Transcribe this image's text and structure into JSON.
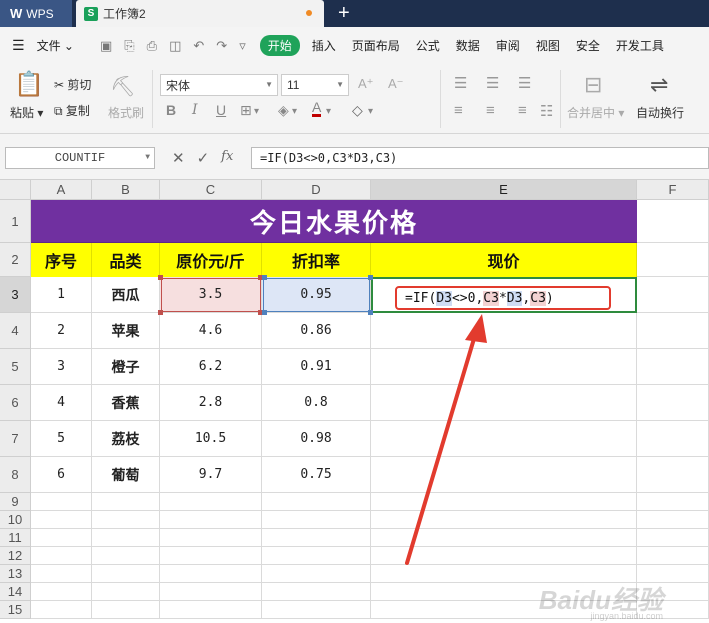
{
  "tabs": {
    "app": "WPS",
    "doc_logo": "S",
    "doc": "工作簿2",
    "add": "+"
  },
  "menu": {
    "file": "文件",
    "items": [
      "开始",
      "插入",
      "页面布局",
      "公式",
      "数据",
      "审阅",
      "视图",
      "安全",
      "开发工具"
    ]
  },
  "ribbon": {
    "paste": "粘贴",
    "cut": "剪切",
    "copy": "复制",
    "format_painter": "格式刷",
    "font_name": "宋体",
    "font_size": "11",
    "merge_center": "合并居中",
    "wrap_text": "自动换行",
    "bold": "B",
    "italic": "I",
    "underline": "U",
    "font_color_letter": "A"
  },
  "formula_bar": {
    "name_box": "COUNTIF",
    "fx": "fx",
    "formula": "=IF(D3<>0,C3*D3,C3)"
  },
  "columns": [
    "A",
    "B",
    "C",
    "D",
    "E",
    "F"
  ],
  "rows": [
    "1",
    "2",
    "3",
    "4",
    "5",
    "6",
    "7",
    "8",
    "9",
    "10",
    "11",
    "12",
    "13",
    "14",
    "15"
  ],
  "sheet": {
    "title": "今日水果价格",
    "headers": [
      "序号",
      "品类",
      "原价元/斤",
      "折扣率",
      "现价"
    ],
    "data": [
      [
        "1",
        "西瓜",
        "3.5",
        "0.95"
      ],
      [
        "2",
        "苹果",
        "4.6",
        "0.86"
      ],
      [
        "3",
        "橙子",
        "6.2",
        "0.91"
      ],
      [
        "4",
        "香蕉",
        "2.8",
        "0.8"
      ],
      [
        "5",
        "荔枝",
        "10.5",
        "0.98"
      ],
      [
        "6",
        "葡萄",
        "9.7",
        "0.75"
      ]
    ],
    "editing_formula_parts": [
      "=IF(",
      "D3",
      "<>0,",
      "C3",
      "*",
      "D3",
      ",",
      "C3",
      ")"
    ]
  },
  "watermark": {
    "main": "Baidu经验",
    "sub": "jingyan.baidu.com"
  },
  "colors": {
    "title_bg": "#7030a0",
    "header_bg": "#ffff00",
    "accent_green": "#1fa35a",
    "annotation_red": "#e23b2e"
  }
}
